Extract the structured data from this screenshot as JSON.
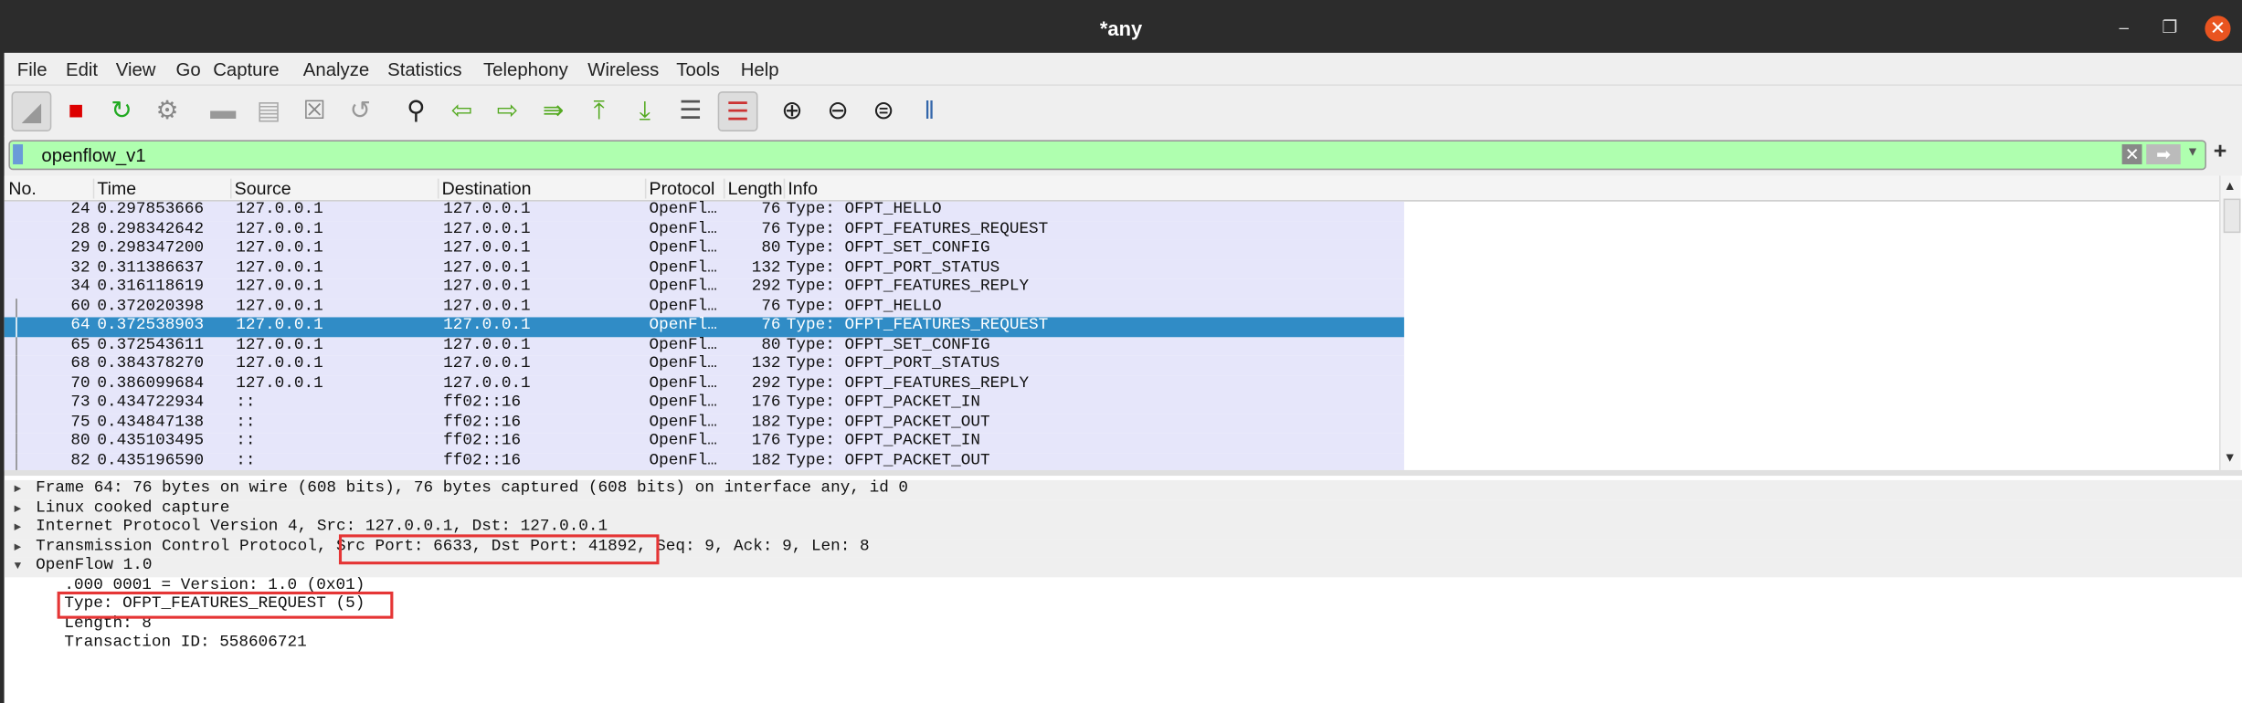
{
  "window": {
    "title": "*any",
    "minimize": "–",
    "restore": "❐",
    "close": "✕"
  },
  "menu": [
    "File",
    "Edit",
    "View",
    "Go",
    "Capture",
    "Analyze",
    "Statistics",
    "Telephony",
    "Wireless",
    "Tools",
    "Help"
  ],
  "toolbar": [
    "shark-fin-start",
    "stop-capture",
    "restart-capture",
    "capture-options",
    "open-file",
    "save-file",
    "close-file",
    "reload-file",
    "find-packet",
    "go-back",
    "go-forward",
    "go-to-packet",
    "go-first",
    "go-last",
    "auto-scroll",
    "colorize",
    "zoom-in",
    "zoom-out",
    "zoom-normal",
    "resize-columns"
  ],
  "filter": {
    "value": "openflow_v1",
    "clear": "✕",
    "apply": "➡",
    "dropdown": "▼",
    "add": "+",
    "color": "#afffaf"
  },
  "columns": [
    "No.",
    "Time",
    "Source",
    "Destination",
    "Protocol",
    "Length",
    "Info"
  ],
  "packets": [
    {
      "no": "24",
      "time": "0.297853666",
      "src": "127.0.0.1",
      "dst": "127.0.0.1",
      "proto": "OpenFl…",
      "len": "76",
      "info": "Type: OFPT_HELLO"
    },
    {
      "no": "28",
      "time": "0.298342642",
      "src": "127.0.0.1",
      "dst": "127.0.0.1",
      "proto": "OpenFl…",
      "len": "76",
      "info": "Type: OFPT_FEATURES_REQUEST"
    },
    {
      "no": "29",
      "time": "0.298347200",
      "src": "127.0.0.1",
      "dst": "127.0.0.1",
      "proto": "OpenFl…",
      "len": "80",
      "info": "Type: OFPT_SET_CONFIG"
    },
    {
      "no": "32",
      "time": "0.311386637",
      "src": "127.0.0.1",
      "dst": "127.0.0.1",
      "proto": "OpenFl…",
      "len": "132",
      "info": "Type: OFPT_PORT_STATUS"
    },
    {
      "no": "34",
      "time": "0.316118619",
      "src": "127.0.0.1",
      "dst": "127.0.0.1",
      "proto": "OpenFl…",
      "len": "292",
      "info": "Type: OFPT_FEATURES_REPLY"
    },
    {
      "no": "60",
      "time": "0.372020398",
      "src": "127.0.0.1",
      "dst": "127.0.0.1",
      "proto": "OpenFl…",
      "len": "76",
      "info": "Type: OFPT_HELLO"
    },
    {
      "no": "64",
      "time": "0.372538903",
      "src": "127.0.0.1",
      "dst": "127.0.0.1",
      "proto": "OpenFl…",
      "len": "76",
      "info": "Type: OFPT_FEATURES_REQUEST",
      "selected": true
    },
    {
      "no": "65",
      "time": "0.372543611",
      "src": "127.0.0.1",
      "dst": "127.0.0.1",
      "proto": "OpenFl…",
      "len": "80",
      "info": "Type: OFPT_SET_CONFIG"
    },
    {
      "no": "68",
      "time": "0.384378270",
      "src": "127.0.0.1",
      "dst": "127.0.0.1",
      "proto": "OpenFl…",
      "len": "132",
      "info": "Type: OFPT_PORT_STATUS"
    },
    {
      "no": "70",
      "time": "0.386099684",
      "src": "127.0.0.1",
      "dst": "127.0.0.1",
      "proto": "OpenFl…",
      "len": "292",
      "info": "Type: OFPT_FEATURES_REPLY"
    },
    {
      "no": "73",
      "time": "0.434722934",
      "src": "::",
      "dst": "ff02::16",
      "proto": "OpenFl…",
      "len": "176",
      "info": "Type: OFPT_PACKET_IN"
    },
    {
      "no": "75",
      "time": "0.434847138",
      "src": "::",
      "dst": "ff02::16",
      "proto": "OpenFl…",
      "len": "182",
      "info": "Type: OFPT_PACKET_OUT"
    },
    {
      "no": "80",
      "time": "0.435103495",
      "src": "::",
      "dst": "ff02::16",
      "proto": "OpenFl…",
      "len": "176",
      "info": "Type: OFPT_PACKET_IN"
    },
    {
      "no": "82",
      "time": "0.435196590",
      "src": "::",
      "dst": "ff02::16",
      "proto": "OpenFl…",
      "len": "182",
      "info": "Type: OFPT_PACKET_OUT"
    }
  ],
  "details": [
    {
      "text": "Frame 64: 76 bytes on wire (608 bits), 76 bytes captured (608 bits) on interface any, id 0",
      "level": 0,
      "expanded": false
    },
    {
      "text": "Linux cooked capture",
      "level": 0,
      "expanded": false
    },
    {
      "text": "Internet Protocol Version 4, Src: 127.0.0.1, Dst: 127.0.0.1",
      "level": 0,
      "expanded": false
    },
    {
      "text": "Transmission Control Protocol, Src Port: 6633, Dst Port: 41892, Seq: 9, Ack: 9, Len: 8",
      "level": 0,
      "expanded": false
    },
    {
      "text": "OpenFlow 1.0",
      "level": 0,
      "expanded": true
    },
    {
      "text": ".000 0001 = Version: 1.0 (0x01)",
      "level": 1
    },
    {
      "text": "Type: OFPT_FEATURES_REQUEST (5)",
      "level": 1
    },
    {
      "text": "Length: 8",
      "level": 1
    },
    {
      "text": "Transaction ID: 558606721",
      "level": 1
    }
  ],
  "colors": {
    "row_bg": "#e6e6fa",
    "selected": "#308cc6",
    "highlight_box": "#e53535"
  }
}
